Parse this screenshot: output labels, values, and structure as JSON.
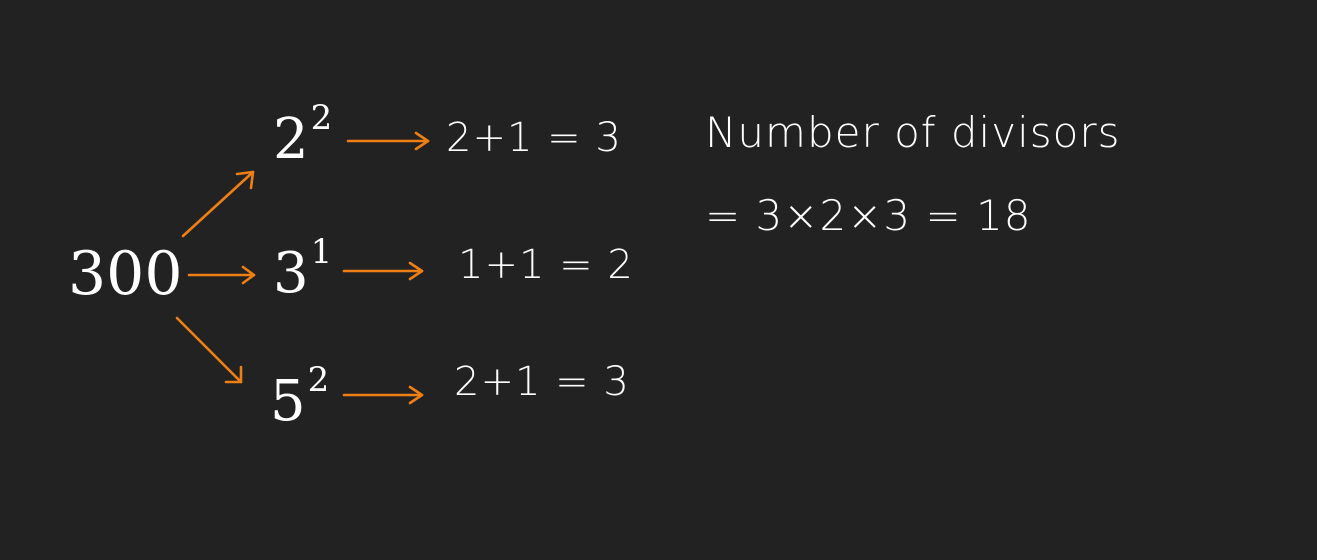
{
  "root": "300",
  "factors": [
    {
      "base": "2",
      "exponent": "2",
      "count_expr": "2+1 = 3"
    },
    {
      "base": "3",
      "exponent": "1",
      "count_expr": "1+1 = 2"
    },
    {
      "base": "5",
      "exponent": "2",
      "count_expr": "2+1 = 3"
    }
  ],
  "summary": {
    "line1": "Number of divisors",
    "line2": "= 3×2×3 = 18"
  },
  "colors": {
    "background": "#222222",
    "text": "#ffffff",
    "arrow": "#ee7f14"
  }
}
